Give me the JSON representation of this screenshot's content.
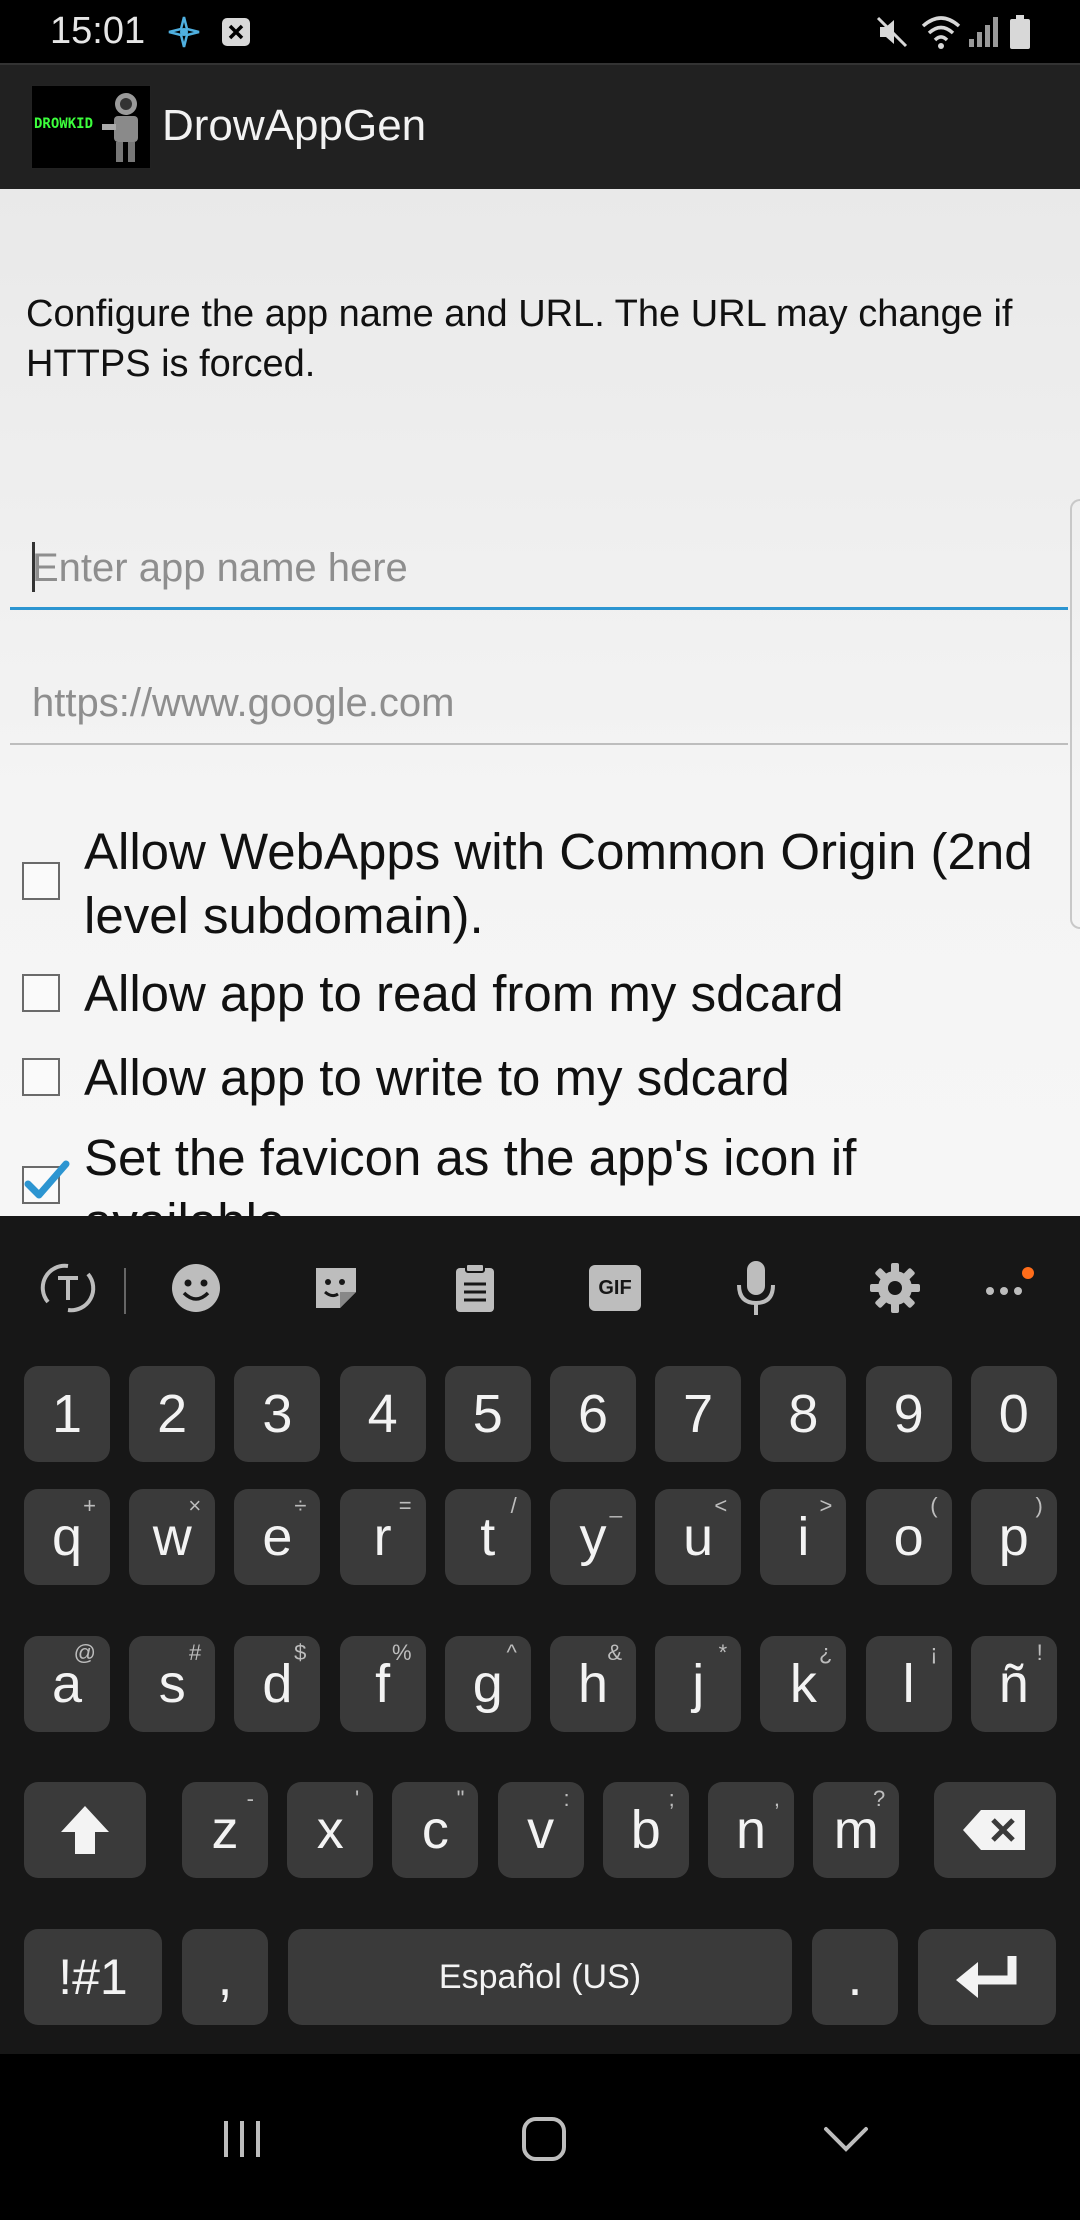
{
  "status_bar": {
    "time": "15:01",
    "icons": [
      "navigation-icon",
      "notification-x-icon",
      "mute-icon",
      "wifi-icon",
      "signal-icon",
      "battery-icon"
    ]
  },
  "action_bar": {
    "logo_text": "DROWKID",
    "title": "DrowAppGen"
  },
  "intro_text": "Configure the app name and URL. The URL may change if HTTPS is forced.",
  "fields": {
    "app_name": {
      "value": "",
      "placeholder": "Enter app name here"
    },
    "url": {
      "value": "",
      "placeholder": "https://www.google.com"
    }
  },
  "options": [
    {
      "label": "Allow WebApps with Common Origin (2nd level subdomain).",
      "checked": false
    },
    {
      "label": "Allow app to read from my sdcard",
      "checked": false
    },
    {
      "label": "Allow app to write to my sdcard",
      "checked": false
    },
    {
      "label": "Set the favicon as the app's icon if available",
      "checked": true
    }
  ],
  "keyboard": {
    "number_row": [
      "1",
      "2",
      "3",
      "4",
      "5",
      "6",
      "7",
      "8",
      "9",
      "0"
    ],
    "row1": [
      {
        "key": "q",
        "hint": "+"
      },
      {
        "key": "w",
        "hint": "×"
      },
      {
        "key": "e",
        "hint": "÷"
      },
      {
        "key": "r",
        "hint": "="
      },
      {
        "key": "t",
        "hint": "/"
      },
      {
        "key": "y",
        "hint": "_"
      },
      {
        "key": "u",
        "hint": "<"
      },
      {
        "key": "i",
        "hint": ">"
      },
      {
        "key": "o",
        "hint": "("
      },
      {
        "key": "p",
        "hint": ")"
      }
    ],
    "row2": [
      {
        "key": "a",
        "hint": "@"
      },
      {
        "key": "s",
        "hint": "#"
      },
      {
        "key": "d",
        "hint": "$"
      },
      {
        "key": "f",
        "hint": "%"
      },
      {
        "key": "g",
        "hint": "^"
      },
      {
        "key": "h",
        "hint": "&"
      },
      {
        "key": "j",
        "hint": "*"
      },
      {
        "key": "k",
        "hint": "¿"
      },
      {
        "key": "l",
        "hint": "¡"
      },
      {
        "key": "ñ",
        "hint": "!"
      }
    ],
    "row3": [
      {
        "key": "z",
        "hint": "-"
      },
      {
        "key": "x",
        "hint": "'"
      },
      {
        "key": "c",
        "hint": "\""
      },
      {
        "key": "v",
        "hint": ":"
      },
      {
        "key": "b",
        "hint": ";"
      },
      {
        "key": "n",
        "hint": ","
      },
      {
        "key": "m",
        "hint": "?"
      }
    ],
    "symbols_label": "!#1",
    "comma_label": ",",
    "space_label": "Español (US)",
    "period_label": ".",
    "toolbar_gif_label": "GIF"
  },
  "colors": {
    "accent": "#2c95d1",
    "notification_dot": "#ff6d1a",
    "checkbox_check": "#2c95d1"
  }
}
